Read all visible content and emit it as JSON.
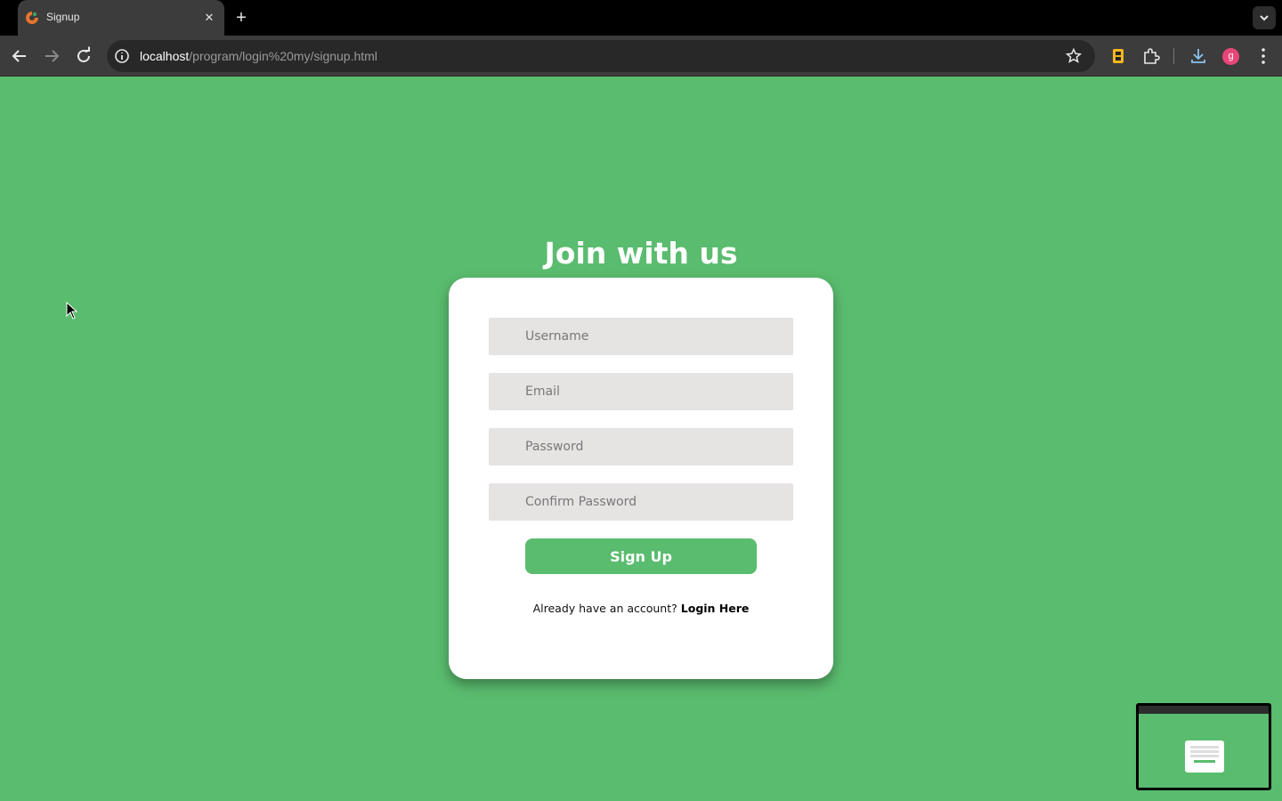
{
  "browser": {
    "tab_title": "Signup",
    "url_host": "localhost",
    "url_path": "/program/login%20my/signup.html",
    "avatar_letter": "g"
  },
  "page": {
    "heading": "Join with us",
    "form": {
      "username_placeholder": "Username",
      "email_placeholder": "Email",
      "password_placeholder": "Password",
      "confirm_password_placeholder": "Confirm Password",
      "submit_label": "Sign Up"
    },
    "login_prompt": "Already have an account?",
    "login_link": "Login Here"
  },
  "colors": {
    "background": "#5abc6e",
    "card": "#ffffff",
    "field": "#e6e3e3",
    "button": "#5abc6e"
  }
}
